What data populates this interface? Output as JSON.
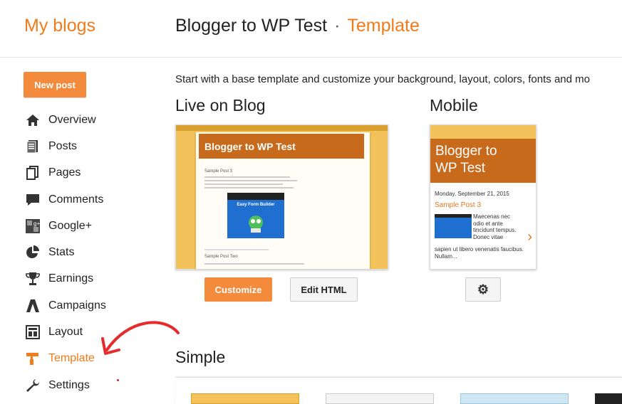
{
  "header": {
    "brand": "My blogs",
    "blog_title": "Blogger to WP Test",
    "separator": "·",
    "section": "Template"
  },
  "sidebar": {
    "new_post_label": "New post",
    "items": [
      {
        "label": "Overview",
        "icon": "home-icon"
      },
      {
        "label": "Posts",
        "icon": "posts-icon"
      },
      {
        "label": "Pages",
        "icon": "pages-icon"
      },
      {
        "label": "Comments",
        "icon": "comments-icon"
      },
      {
        "label": "Google+",
        "icon": "google-plus-icon"
      },
      {
        "label": "Stats",
        "icon": "stats-icon"
      },
      {
        "label": "Earnings",
        "icon": "trophy-icon"
      },
      {
        "label": "Campaigns",
        "icon": "campaigns-icon"
      },
      {
        "label": "Layout",
        "icon": "layout-icon"
      },
      {
        "label": "Template",
        "icon": "template-icon",
        "active": true
      },
      {
        "label": "Settings",
        "icon": "wrench-icon"
      }
    ]
  },
  "main": {
    "intro": "Start with a base template and customize your background, layout, colors, fonts and mo",
    "live_heading": "Live on Blog",
    "mobile_heading": "Mobile",
    "simple_heading": "Simple",
    "live_preview": {
      "blog_title": "Blogger to WP Test",
      "post_title": "Sample Post 3",
      "video_title": "Easy Form Builder",
      "second_post": "Sample Post Two"
    },
    "mobile_preview": {
      "blog_title_line1": "Blogger to",
      "blog_title_line2": "WP Test",
      "date": "Monday, September 21, 2015",
      "post_title": "Sample Post 3",
      "snippet": "Maecenas nec odio et ante tincidunt tempus. Donec vitae",
      "snippet_cont": "sapien ut libero venenatis faucibus. Nullam..."
    },
    "buttons": {
      "customize": "Customize",
      "edit_html": "Edit HTML"
    }
  },
  "colors": {
    "accent": "#f07b1b",
    "button": "#f48a3c",
    "blog_header": "#c86a1c",
    "blog_bg": "#f3c25a"
  }
}
